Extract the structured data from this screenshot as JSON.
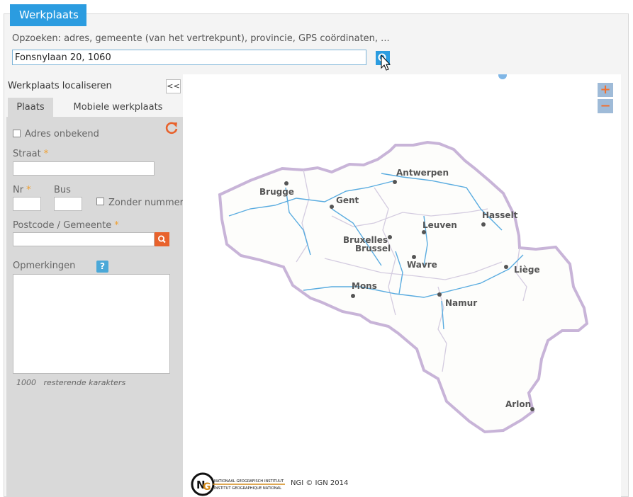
{
  "header": {
    "title": "Werkplaats"
  },
  "search": {
    "label": "Opzoeken: adres, gemeente (van het vertrekpunt), provincie, GPS coördinaten, ...",
    "value": "Fonsnylaan 20, 1060",
    "button_icon": "search-icon"
  },
  "left_panel": {
    "title": "Werkplaats localiseren",
    "collapse_label": "<<",
    "tabs": [
      {
        "label": "Plaats",
        "active": true
      },
      {
        "label": "Mobiele werkplaats",
        "active": false
      }
    ],
    "form": {
      "address_unknown": "Adres onbekend",
      "street_label": "Straat",
      "nr_label": "Nr",
      "bus_label": "Bus",
      "no_number": "Zonder nummer",
      "postcode_label": "Postcode / Gemeente",
      "remarks_label": "Opmerkingen",
      "help": "?",
      "required_mark": "*",
      "counter_value": "1000",
      "counter_text": "resterende karakters"
    }
  },
  "map": {
    "zoom_in": "+",
    "zoom_out": "−",
    "cities": [
      "Antwerpen",
      "Brugge",
      "Gent",
      "Hasselt",
      "Leuven",
      "Bruxelles",
      "Brussel",
      "Wavre",
      "Liège",
      "Mons",
      "Namur",
      "Arlon"
    ],
    "logo_line1": "NATIONAAL GEOGRAFISCH INSTITUUT",
    "logo_line2": "INSTITUT GEOGRAPHIQUE NATIONAL",
    "attribution": "NGI © IGN 2014"
  },
  "colors": {
    "accent": "#2b9ce0",
    "orange": "#e8622c",
    "panel_gray": "#d9d9d9",
    "border_purple": "#c8b4d8"
  }
}
